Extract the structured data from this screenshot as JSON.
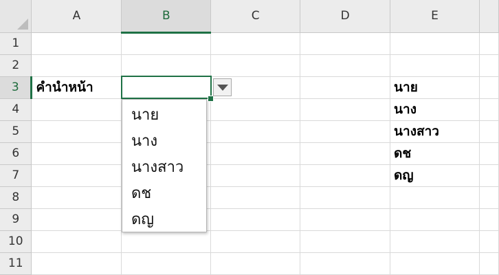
{
  "spreadsheet": {
    "columns": [
      "A",
      "B",
      "C",
      "D",
      "E"
    ],
    "active_column": "B",
    "rows": [
      "1",
      "2",
      "3",
      "4",
      "5",
      "6",
      "7",
      "8",
      "9",
      "10",
      "11"
    ],
    "active_row": "3",
    "cells": {
      "A3": "คำนำหน้า",
      "E3": "นาย",
      "E4": "นาง",
      "E5": "นางสาว",
      "E6": "ดช",
      "E7": "ดญ"
    },
    "selected_cell": "B3",
    "selected_cell_value": ""
  },
  "dropdown": {
    "options": [
      "นาย",
      "นาง",
      "นางสาว",
      "ดช",
      "ดญ"
    ]
  },
  "colors": {
    "accent": "#1e7145",
    "header_bg": "#ececec",
    "gridline": "#d9d9d9"
  }
}
